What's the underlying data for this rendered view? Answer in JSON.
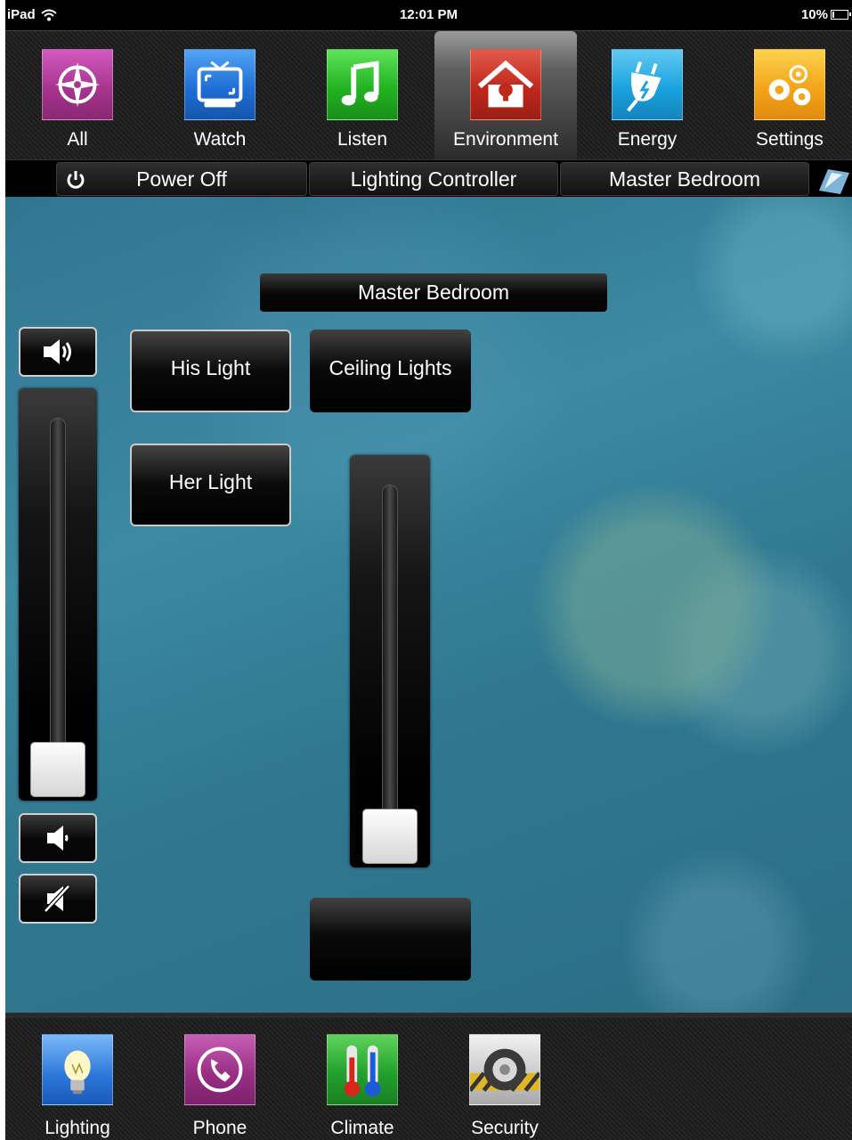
{
  "status_bar": {
    "device": "iPad",
    "time": "12:01 PM",
    "battery": "10%",
    "battery_level": 0.1
  },
  "top_nav": [
    {
      "label": "All",
      "icon": "compass-icon",
      "color": "#a8358f",
      "active": false
    },
    {
      "label": "Watch",
      "icon": "tv-icon",
      "color": "#1f6fd6",
      "active": false
    },
    {
      "label": "Listen",
      "icon": "music-note-icon",
      "color": "#23b322",
      "active": false
    },
    {
      "label": "Environment",
      "icon": "house-icon",
      "color": "#c0281c",
      "active": true
    },
    {
      "label": "Energy",
      "icon": "plug-icon",
      "color": "#1aa3e0",
      "active": false
    },
    {
      "label": "Settings",
      "icon": "gears-icon",
      "color": "#f3a51b",
      "active": false
    }
  ],
  "sub_bar": {
    "power": "Power Off",
    "controller": "Lighting Controller",
    "room": "Master Bedroom"
  },
  "main": {
    "room_title": "Master Bedroom",
    "his_light": "His Light",
    "her_light": "Her Light",
    "ceiling_lights": "Ceiling Lights",
    "volume_level": 0.0,
    "ceiling_level": 0.0
  },
  "bottom_nav": [
    {
      "label": "Lighting",
      "icon": "lightbulb-icon",
      "color": "#2a76d8"
    },
    {
      "label": "Phone",
      "icon": "phone-icon",
      "color": "#9b2f86"
    },
    {
      "label": "Climate",
      "icon": "thermometer-icon",
      "color": "#23a12d"
    },
    {
      "label": "Security",
      "icon": "safe-dial-icon",
      "color": "#cfcfcf"
    }
  ]
}
